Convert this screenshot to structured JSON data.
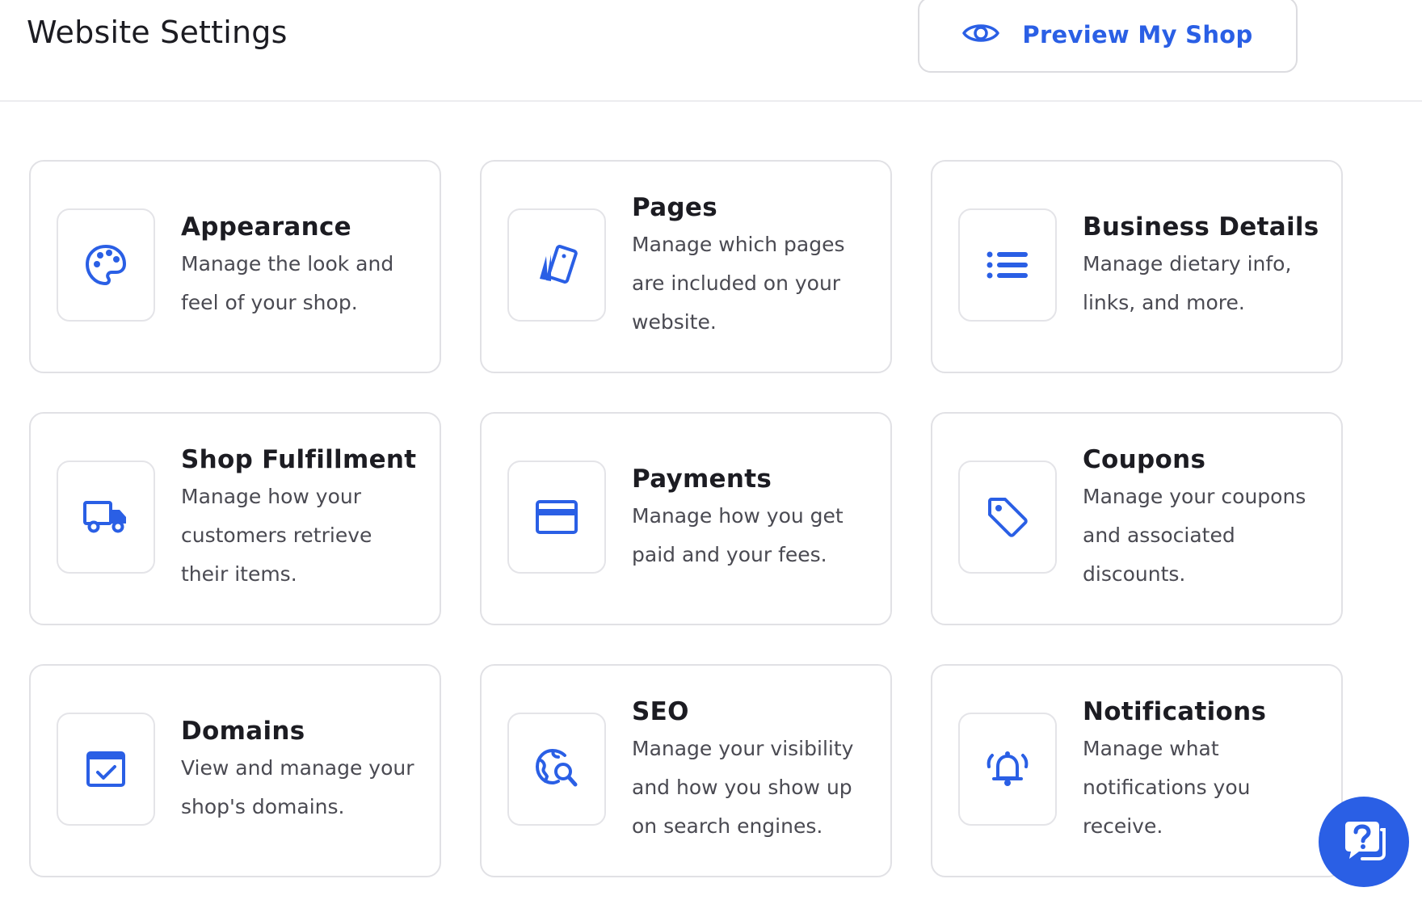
{
  "header": {
    "title": "Website Settings",
    "preview_label": "Preview My Shop"
  },
  "cards": [
    {
      "title": "Appearance",
      "description": "Manage the look and feel of your shop.",
      "icon": "palette-icon"
    },
    {
      "title": "Pages",
      "description": "Manage which pages are included on your website.",
      "icon": "pages-icon"
    },
    {
      "title": "Business Details",
      "description": "Manage dietary info, links, and more.",
      "icon": "list-icon"
    },
    {
      "title": "Shop Fulfillment",
      "description": "Manage how your customers retrieve their items.",
      "icon": "truck-icon"
    },
    {
      "title": "Payments",
      "description": "Manage how you get paid and your fees.",
      "icon": "credit-card-icon"
    },
    {
      "title": "Coupons",
      "description": "Manage your coupons and associated discounts.",
      "icon": "tag-icon"
    },
    {
      "title": "Domains",
      "description": "View and manage your shop's domains.",
      "icon": "browser-check-icon"
    },
    {
      "title": "SEO",
      "description": "Manage your visibility and how you show up on search engines.",
      "icon": "globe-search-icon"
    },
    {
      "title": "Notifications",
      "description": "Manage what notifications you receive.",
      "icon": "bell-icon"
    }
  ],
  "help": {
    "icon": "help-chat-icon"
  },
  "colors": {
    "accent": "#2a5fe5",
    "border": "#e1e1e5",
    "text": "#1c1c22",
    "muted": "#4a4a52"
  }
}
